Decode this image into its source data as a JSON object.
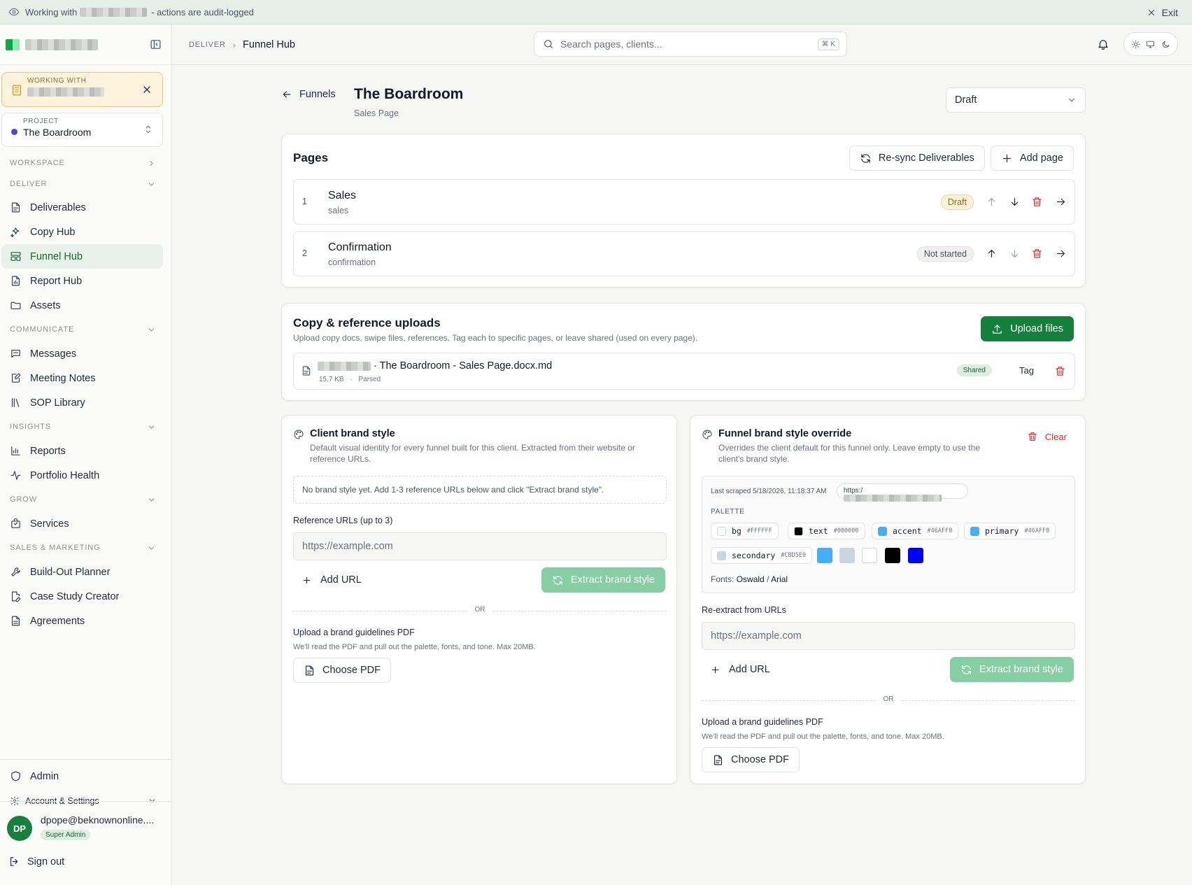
{
  "banner": {
    "prefix": "Working with",
    "suffix": "- actions are audit-logged",
    "exit_label": "Exit"
  },
  "sidebar": {
    "working_with_label": "WORKING WITH",
    "project_label": "PROJECT",
    "project_name": "The Boardroom",
    "sections": {
      "workspace": "WORKSPACE",
      "deliver": "DELIVER",
      "communicate": "COMMUNICATE",
      "insights": "INSIGHTS",
      "grow": "GROW",
      "sales_marketing": "SALES & MARKETING"
    },
    "items": {
      "deliverables": "Deliverables",
      "copy_hub": "Copy Hub",
      "funnel_hub": "Funnel Hub",
      "report_hub": "Report Hub",
      "assets": "Assets",
      "messages": "Messages",
      "meeting_notes": "Meeting Notes",
      "sop_library": "SOP Library",
      "reports": "Reports",
      "portfolio_health": "Portfolio Health",
      "services": "Services",
      "build_out_planner": "Build-Out Planner",
      "case_study_creator": "Case Study Creator",
      "agreements": "Agreements",
      "admin": "Admin",
      "account_settings": "Account & Settings"
    },
    "user": {
      "initials": "DP",
      "email": "dpope@beknownonline....",
      "role": "Super Admin"
    },
    "sign_out": "Sign out"
  },
  "header": {
    "breadcrumb_parent": "DELIVER",
    "breadcrumb_current": "Funnel Hub",
    "search_placeholder": "Search pages, clients...",
    "search_shortcut": "⌘ K"
  },
  "page": {
    "back_label": "Funnels",
    "title": "The Boardroom",
    "subtitle": "Sales Page",
    "status": "Draft"
  },
  "pages_card": {
    "title": "Pages",
    "resync_label": "Re-sync Deliverables",
    "add_page_label": "Add page",
    "rows": [
      {
        "num": "1",
        "name": "Sales",
        "slug": "sales",
        "status": "Draft"
      },
      {
        "num": "2",
        "name": "Confirmation",
        "slug": "confirmation",
        "status": "Not started"
      }
    ]
  },
  "uploads": {
    "title": "Copy & reference uploads",
    "subtitle": "Upload copy docs, swipe files, references. Tag each to specific pages, or leave shared (used on every page).",
    "upload_label": "Upload files",
    "file": {
      "name": "· The Boardroom - Sales Page.docx.md",
      "size": "15.7 KB",
      "state": "Parsed",
      "scope": "Shared",
      "tag_label": "Tag"
    }
  },
  "client_brand": {
    "title": "Client brand style",
    "description": "Default visual identity for every funnel built for this client. Extracted from their website or reference URLs.",
    "empty_text": "No brand style yet. Add 1-3 reference URLs below and click \"Extract brand style\".",
    "ref_label": "Reference URLs (up to 3)",
    "url_placeholder": "https://example.com",
    "add_url": "Add URL",
    "extract_label": "Extract brand style",
    "or": "OR",
    "pdf_label": "Upload a brand guidelines PDF",
    "pdf_note": "We'll read the PDF and pull out the palette, fonts, and tone. Max 20MB.",
    "choose_pdf": "Choose PDF"
  },
  "funnel_brand": {
    "title": "Funnel brand style override",
    "description": "Overrides the client default for this funnel only. Leave empty to use the client's brand style.",
    "clear_label": "Clear",
    "last_scraped": "Last scraped 5/18/2026, 11:18:37 AM",
    "scraped_url": "https:/",
    "palette_label": "PALETTE",
    "palette": [
      {
        "name": "bg",
        "hex": "#FFFFFF"
      },
      {
        "name": "text",
        "hex": "#000000"
      },
      {
        "name": "accent",
        "hex": "#46AFF8"
      },
      {
        "name": "primary",
        "hex": "#46AFF8"
      },
      {
        "name": "secondary",
        "hex": "#CBD5E0"
      }
    ],
    "extra_swatches": [
      "#46AFF8",
      "#CBD5E0",
      "#FFFFFF",
      "#000000",
      "#0000FF"
    ],
    "fonts_label": "Fonts:",
    "font_heading": "Oswald",
    "font_sep": "/",
    "font_body": "Arial",
    "reextract_label": "Re-extract from URLs",
    "url_placeholder": "https://example.com",
    "add_url": "Add URL",
    "extract_label": "Extract brand style",
    "or": "OR",
    "pdf_label": "Upload a brand guidelines PDF",
    "pdf_note": "We'll read the PDF and pull out the palette, fonts, and tone. Max 20MB.",
    "choose_pdf": "Choose PDF"
  }
}
